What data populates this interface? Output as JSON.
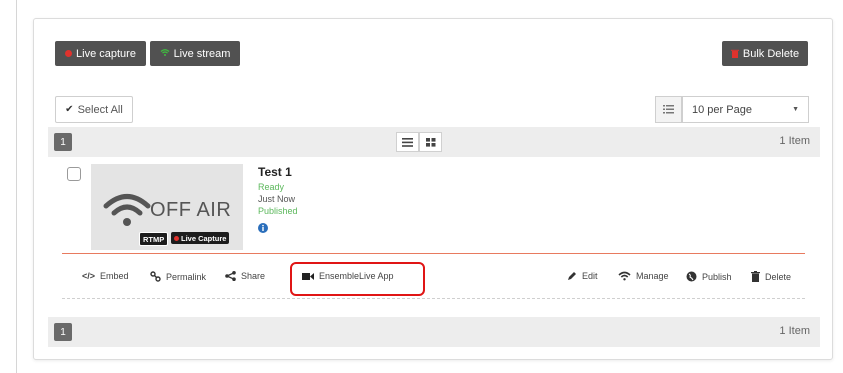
{
  "toolbar": {
    "live_capture": "Live capture",
    "live_stream": "Live stream",
    "bulk_delete": "Bulk Delete"
  },
  "list_controls": {
    "select_all": "Select All",
    "per_page": "10 per Page"
  },
  "pagination_top": {
    "page": "1",
    "count": "1 Item"
  },
  "pagination_bottom": {
    "page": "1",
    "count": "1 Item"
  },
  "item": {
    "title": "Test 1",
    "status": "Ready",
    "time": "Just Now",
    "publish_state": "Published",
    "thumbnail_text": "OFF AIR",
    "tag_rtmp": "RTMP",
    "tag_capture": "Live Capture"
  },
  "actions": {
    "embed": "Embed",
    "permalink": "Permalink",
    "share": "Share",
    "ensemble_app": "EnsembleLive App",
    "edit": "Edit",
    "manage": "Manage",
    "publish": "Publish",
    "delete": "Delete"
  },
  "colors": {
    "status_green": "#5cb85c",
    "info_blue": "#2a6ebb",
    "highlight_red": "#e01515",
    "dark_button": "#515151"
  }
}
